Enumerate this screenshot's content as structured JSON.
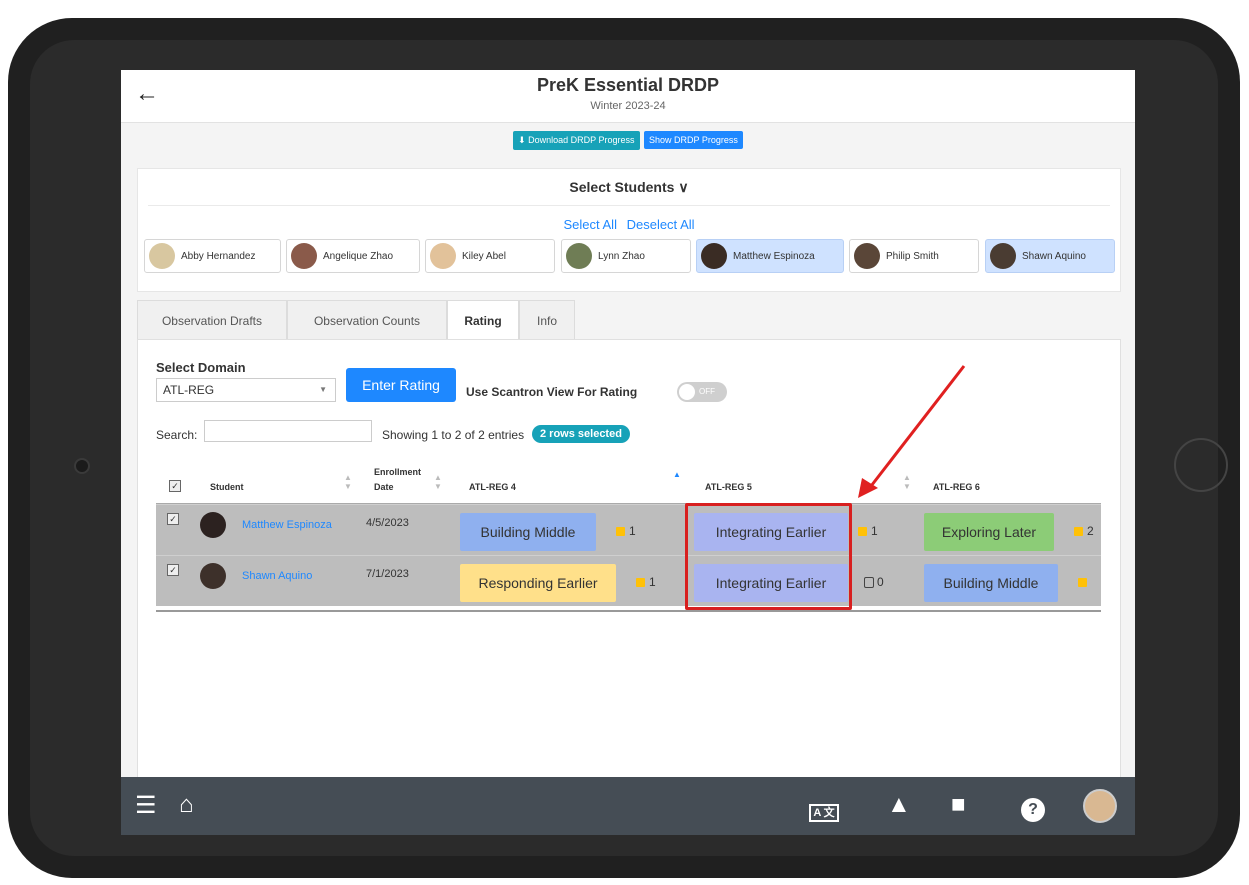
{
  "header": {
    "title": "PreK Essential DRDP",
    "subtitle": "Winter 2023-24",
    "download_label": "Download DRDP Progress",
    "show_label": "Show DRDP Progress"
  },
  "students": {
    "title": "Select Students ∨",
    "select_all": "Select All",
    "deselect_all": "Deselect All",
    "chips": [
      {
        "name": "Abby Hernandez",
        "selected": false
      },
      {
        "name": "Angelique Zhao",
        "selected": false
      },
      {
        "name": "Kiley Abel",
        "selected": false
      },
      {
        "name": "Lynn Zhao",
        "selected": false
      },
      {
        "name": "Matthew Espinoza",
        "selected": true
      },
      {
        "name": "Philip Smith",
        "selected": false
      },
      {
        "name": "Shawn Aquino",
        "selected": true
      }
    ]
  },
  "tabs": [
    "Observation Drafts",
    "Observation Counts",
    "Rating",
    "Info"
  ],
  "active_tab": "Rating",
  "rating": {
    "domain_label": "Select Domain",
    "domain_value": "ATL-REG",
    "enter_rating": "Enter Rating",
    "scantron_label": "Use Scantron View For Rating",
    "toggle_text": "OFF",
    "search_label": "Search:",
    "search_value": "",
    "showing": "Showing 1 to 2 of 2 entries",
    "rows_selected": "2 rows selected"
  },
  "table": {
    "headers": {
      "student": "Student",
      "enroll1": "Enrollment",
      "enroll2": "Date",
      "c4": "ATL-REG 4",
      "c5": "ATL-REG 5",
      "c6": "ATL-REG 6"
    },
    "rows": [
      {
        "name": "Matthew Espinoza",
        "date": "4/5/2023",
        "r4": "Building Middle",
        "n4": "1",
        "r5": "Integrating Earlier",
        "n5": "1",
        "r6": "Exploring Later",
        "n6": "2"
      },
      {
        "name": "Shawn Aquino",
        "date": "7/1/2023",
        "r4": "Responding Earlier",
        "n4": "1",
        "r5": "Integrating Earlier",
        "n5": "0",
        "r6": "Building Middle",
        "n6": ""
      }
    ]
  },
  "colors": {
    "accent_blue": "#1e88ff",
    "teal": "#17a2b8",
    "building": "#8fb0ef",
    "integrating": "#a9b4f0",
    "exploring": "#8ccc77",
    "responding": "#ffe08a",
    "highlight": "#d81f1f"
  },
  "bottom_bar": [
    "menu-icon",
    "home-icon",
    "translate-icon",
    "bell-icon",
    "chat-icon",
    "help-icon",
    "avatar"
  ]
}
